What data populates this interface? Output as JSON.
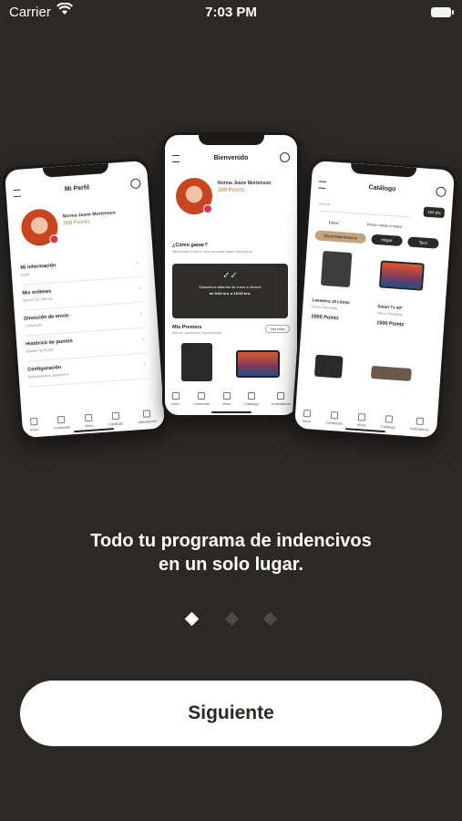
{
  "status_bar": {
    "carrier": "Carrier",
    "time": "7:03 PM"
  },
  "phones": {
    "left": {
      "title": "Mi Perfil",
      "user_name": "Norma Jeane Mortenson",
      "points": "269 Pointz",
      "menu": [
        {
          "title": "Mi información",
          "subtitle": "Perfil"
        },
        {
          "title": "Mis ordenes",
          "subtitle": "Tienes 12 ordenes"
        },
        {
          "title": "Dirección de envío",
          "subtitle": "1 dirección"
        },
        {
          "title": "Histórico de puntos",
          "subtitle": "Detalle de Pointz"
        },
        {
          "title": "Configuración",
          "subtitle": "Notificaciones, password"
        }
      ],
      "tabs": [
        "Inicio",
        "Contenido",
        "Muro",
        "Catálogo",
        "Indicadores"
      ]
    },
    "center": {
      "title": "Bienvenido",
      "user_name": "Norma Jeane Mortenson",
      "points": "269 Pointz",
      "how_title": "¿Cómo ganar?",
      "how_subtitle": "Mecánicas y todo lo que necesitas saber para ganar.",
      "card_text": "Estaremos abiertos de lunes a viernes",
      "card_hours": "de 9:00 hrs. a 19:00 hrs.",
      "prizes_title": "Mis Premios",
      "prizes_subtitle": "Bienes, productos, experiencias",
      "see_all": "Ver todo",
      "tabs": [
        "Inicio",
        "Contenido",
        "Muro",
        "Catálogo",
        "Indicadores"
      ]
    },
    "right": {
      "title": "Catálogo",
      "search_placeholder": "Buscar",
      "points_badge": "164 pts",
      "filters_label": "Filtros",
      "sort_label": "Precio: menor a mayor",
      "chips": [
        "Electrodomésticos",
        "Hogar",
        "Tecn"
      ],
      "products": [
        {
          "name": "Lavadora 15 Libras",
          "brand": "Marca Samsung",
          "points": "2000 Pointz"
        },
        {
          "name": "Smart Tv 40\"",
          "brand": "Marca Samsung",
          "points": "1500 Pointz"
        }
      ],
      "tabs": [
        "Inicio",
        "Contenido",
        "Muro",
        "Catálogo",
        "Indicadores"
      ]
    }
  },
  "headline_line1": "Todo tu programa de indencivos",
  "headline_line2": "en un solo lugar.",
  "pager": {
    "count": 3,
    "active": 0
  },
  "next_button": "Siguiente"
}
